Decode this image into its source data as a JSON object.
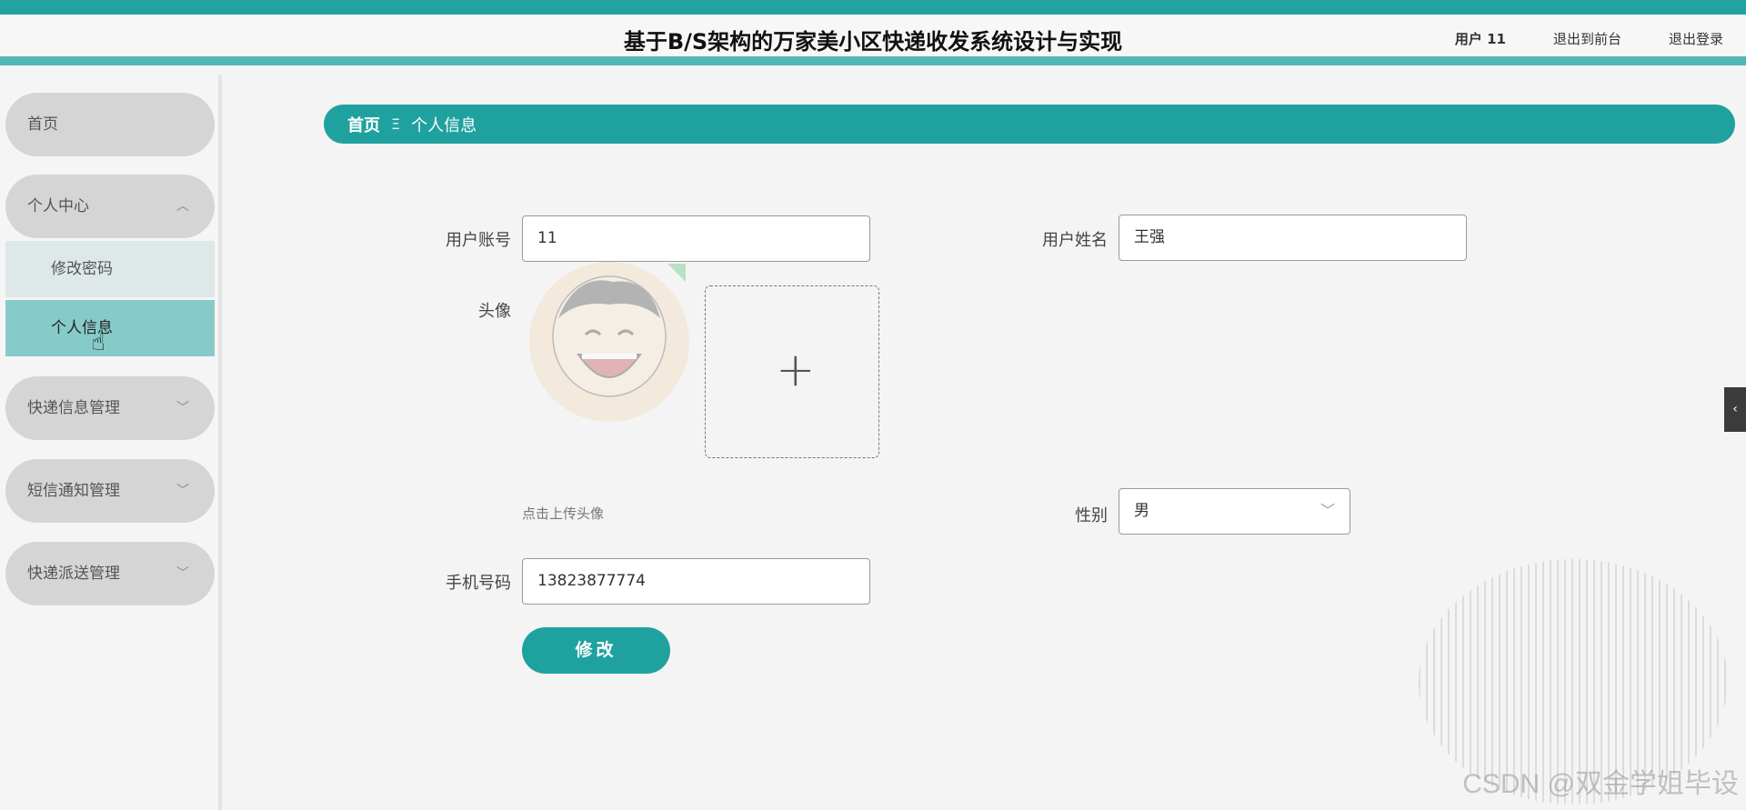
{
  "header": {
    "title": "基于B/S架构的万家美小区快递收发系统设计与实现",
    "user": "用户 11",
    "to_front": "退出到前台",
    "logout": "退出登录"
  },
  "sidebar": {
    "home": "首页",
    "personal_center": "个人中心",
    "change_password": "修改密码",
    "personal_info": "个人信息",
    "express_info": "快递信息管理",
    "sms_notice": "短信通知管理",
    "delivery": "快递派送管理"
  },
  "breadcrumb": {
    "home": "首页",
    "separator": "Ξ",
    "current": "个人信息"
  },
  "form": {
    "account_label": "用户账号",
    "account_value": "11",
    "name_label": "用户姓名",
    "name_value": "王强",
    "avatar_label": "头像",
    "upload_plus": "+",
    "upload_hint": "点击上传头像",
    "gender_label": "性别",
    "gender_value": "男",
    "phone_label": "手机号码",
    "phone_value": "13823877774",
    "submit": "修改"
  },
  "watermark": "CSDN @双金学姐毕设",
  "colors": {
    "primary": "#1fa29f",
    "active_menu": "#86cbc9",
    "menu_bg": "#d6d5d5"
  },
  "icons": {
    "expand": "chevron-up-icon",
    "collapse": "chevron-down-icon",
    "side_tab": "chevron-left-icon"
  }
}
